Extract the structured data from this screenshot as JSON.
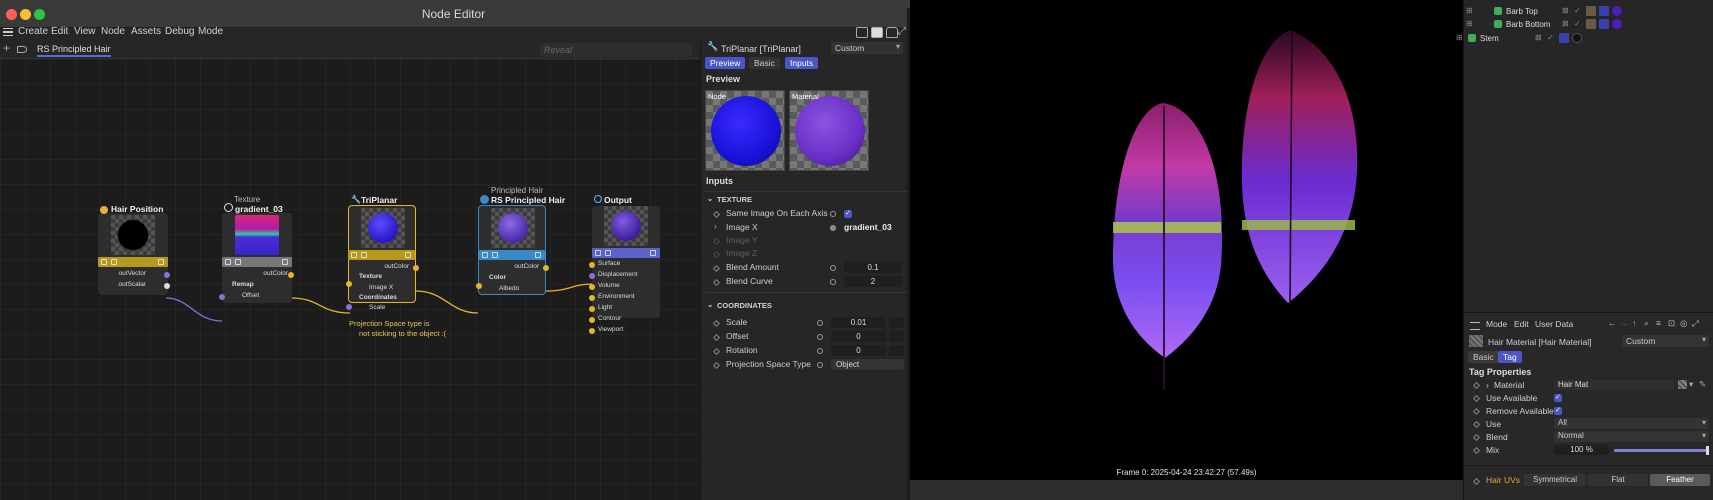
{
  "window": {
    "title": "Node Editor"
  },
  "menu": [
    "Create",
    "Edit",
    "View",
    "Node",
    "Assets",
    "Debug",
    "Mode"
  ],
  "graph_tab": "RS Principled Hair",
  "reveal_placeholder": "Reveal",
  "nodes": {
    "hair_position": {
      "title": "Hair Position",
      "ports": [
        "outVector",
        "outScalar"
      ]
    },
    "texture": {
      "subtitle": "Texture",
      "title": "gradient_03",
      "ports": [
        "outColor",
        "Remap",
        "Offset"
      ]
    },
    "triplanar": {
      "title": "TriPlanar",
      "ports": [
        "outColor",
        "Texture",
        "Image X",
        "Coordinates",
        "Scale"
      ]
    },
    "principled": {
      "subtitle": "Principled Hair",
      "title": "RS Principled Hair",
      "ports": [
        "outColor",
        "Color",
        "Albedo"
      ]
    },
    "output": {
      "title": "Output",
      "ports": [
        "Surface",
        "Displacement",
        "Volume",
        "Environment",
        "Light",
        "Contour",
        "Viewport"
      ]
    }
  },
  "note": {
    "line1": "Projection Space type is",
    "line2": "not sticking to the object :("
  },
  "inspector": {
    "title": "TriPlanar [TriPlanar]",
    "mode": "Custom",
    "tabs": [
      "Preview",
      "Basic",
      "Inputs"
    ],
    "preview_heading": "Preview",
    "preview_node": "Node",
    "preview_material": "Material",
    "inputs_heading": "Inputs",
    "texture_group": "TEXTURE",
    "texture_rows": {
      "same_image": "Same Image On Each Axis",
      "image_x": "Image X",
      "image_x_value": "gradient_03",
      "image_y": "Image Y",
      "image_z": "Image Z",
      "blend_amount": "Blend Amount",
      "blend_amount_value": "0.1",
      "blend_curve": "Blend Curve",
      "blend_curve_value": "2"
    },
    "coord_group": "COORDINATES",
    "coord_rows": {
      "scale": "Scale",
      "scale_value": "0.01",
      "offset": "Offset",
      "offset_value": "0",
      "rotation": "Rotation",
      "rotation_value": "0",
      "proj_type": "Projection Space Type",
      "proj_type_value": "Object"
    }
  },
  "viewport": {
    "frame_info": "Frame  0:  2025-04-24  23:42:27  (57.49s)"
  },
  "object_manager": {
    "rows": [
      "Barb Top",
      "Barb Bottom",
      "Stem"
    ]
  },
  "attribute_manager": {
    "menu": [
      "Mode",
      "Edit",
      "User Data"
    ],
    "object": "Hair Material [Hair Material]",
    "mode": "Custom",
    "tabs": [
      "Basic",
      "Tag"
    ],
    "section": "Tag Properties",
    "material_label": "Material",
    "material_value": "Hair Mat",
    "use_available": "Use Available",
    "remove_available": "Remove Available",
    "use_label": "Use",
    "use_value": "All",
    "blend_label": "Blend",
    "blend_value": "Normal",
    "mix_label": "Mix",
    "mix_value": "100 %",
    "mix_fraction": 1.0,
    "hair_uvs": "Hair UVs",
    "uv_modes": [
      "Symmetrical",
      "Flat",
      "Feather"
    ],
    "uv_selected": "Feather"
  },
  "colors": {
    "accent": "#4c6ed8",
    "node_yellow": "#b59a1e",
    "node_blue": "#3a89c5",
    "wire_yellow": "#e5b52a",
    "wire_purple": "#8e6fd8"
  }
}
